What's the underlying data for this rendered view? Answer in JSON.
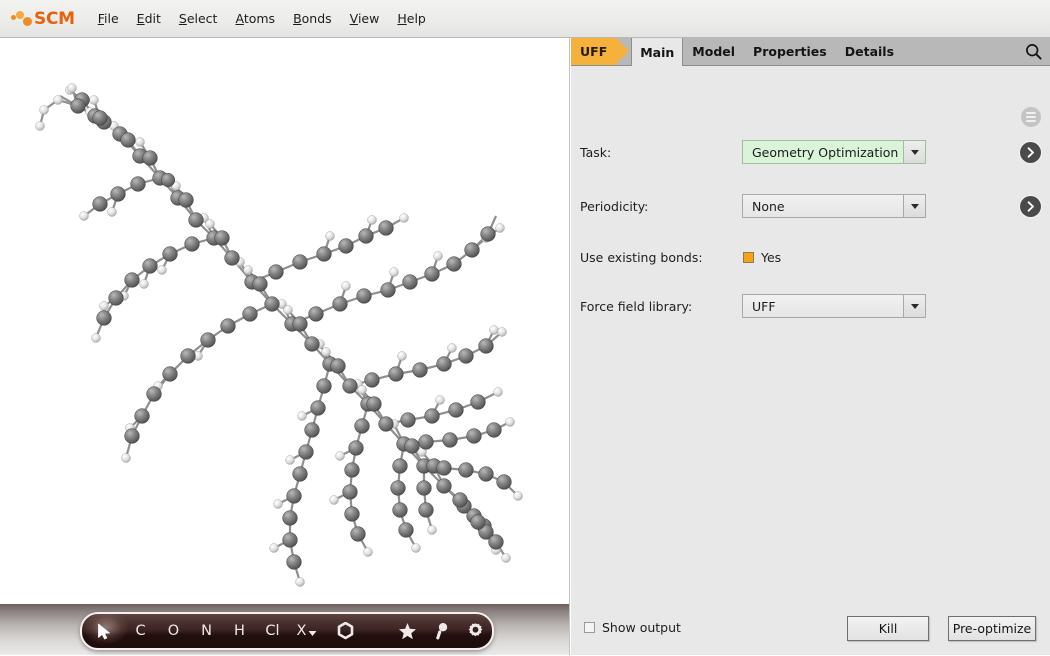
{
  "app": {
    "brand": "SCM",
    "menus": [
      {
        "label": "File",
        "mnemonic": "F"
      },
      {
        "label": "Edit",
        "mnemonic": "E"
      },
      {
        "label": "Select",
        "mnemonic": "S"
      },
      {
        "label": "Atoms",
        "mnemonic": "A"
      },
      {
        "label": "Bonds",
        "mnemonic": "B"
      },
      {
        "label": "View",
        "mnemonic": "V"
      },
      {
        "label": "Help",
        "mnemonic": "H"
      }
    ]
  },
  "viewport": {
    "name": "molecule-3d-view",
    "background": "#ffffff",
    "representation": "ball-and-stick",
    "atom_colors": {
      "carbon": "#6e6e6e",
      "hydrogen": "#e8e8e8"
    }
  },
  "toolbar": {
    "tools": [
      {
        "name": "select-cursor-tool",
        "label": "",
        "icon": "cursor-arrow-icon",
        "selected": true
      },
      {
        "name": "element-c-tool",
        "label": "C",
        "selected": false
      },
      {
        "name": "element-o-tool",
        "label": "O",
        "selected": false
      },
      {
        "name": "element-n-tool",
        "label": "N",
        "selected": false
      },
      {
        "name": "element-h-tool",
        "label": "H",
        "selected": false
      },
      {
        "name": "element-cl-tool",
        "label": "Cl",
        "selected": false
      },
      {
        "name": "element-x-tool",
        "label": "X",
        "icon": "chevron-down-icon",
        "selected": false
      },
      {
        "name": "benzene-ring-tool",
        "label": "",
        "icon": "hexagon-ring-icon",
        "selected": false
      },
      {
        "name": "favorites-tool",
        "label": "",
        "icon": "star-icon",
        "selected": false
      },
      {
        "name": "search-atom-tool",
        "label": "",
        "icon": "magnifier-icon",
        "selected": false
      },
      {
        "name": "preferences-tool",
        "label": "",
        "icon": "gear-icon",
        "selected": false
      }
    ]
  },
  "panel": {
    "badge": "UFF",
    "tabs": [
      {
        "label": "Main",
        "active": true
      },
      {
        "label": "Model",
        "active": false
      },
      {
        "label": "Properties",
        "active": false
      },
      {
        "label": "Details",
        "active": false
      }
    ],
    "search_icon": "magnifier-icon",
    "menu_icon": "hamburger-icon",
    "fields": {
      "task": {
        "label": "Task:",
        "value": "Geometry Optimization",
        "highlight_color": "#d9f4d9",
        "has_detail_button": true
      },
      "periodicity": {
        "label": "Periodicity:",
        "value": "None",
        "has_detail_button": true
      },
      "use_existing_bonds": {
        "label": "Use existing bonds:",
        "value": "Yes",
        "checked": true,
        "check_color": "#f5a215"
      },
      "force_field_library": {
        "label": "Force field library:",
        "value": "UFF",
        "has_detail_button": false
      }
    },
    "footer": {
      "show_output_label": "Show output",
      "show_output_checked": false,
      "kill_label": "Kill",
      "preoptimize_label": "Pre-optimize"
    }
  }
}
